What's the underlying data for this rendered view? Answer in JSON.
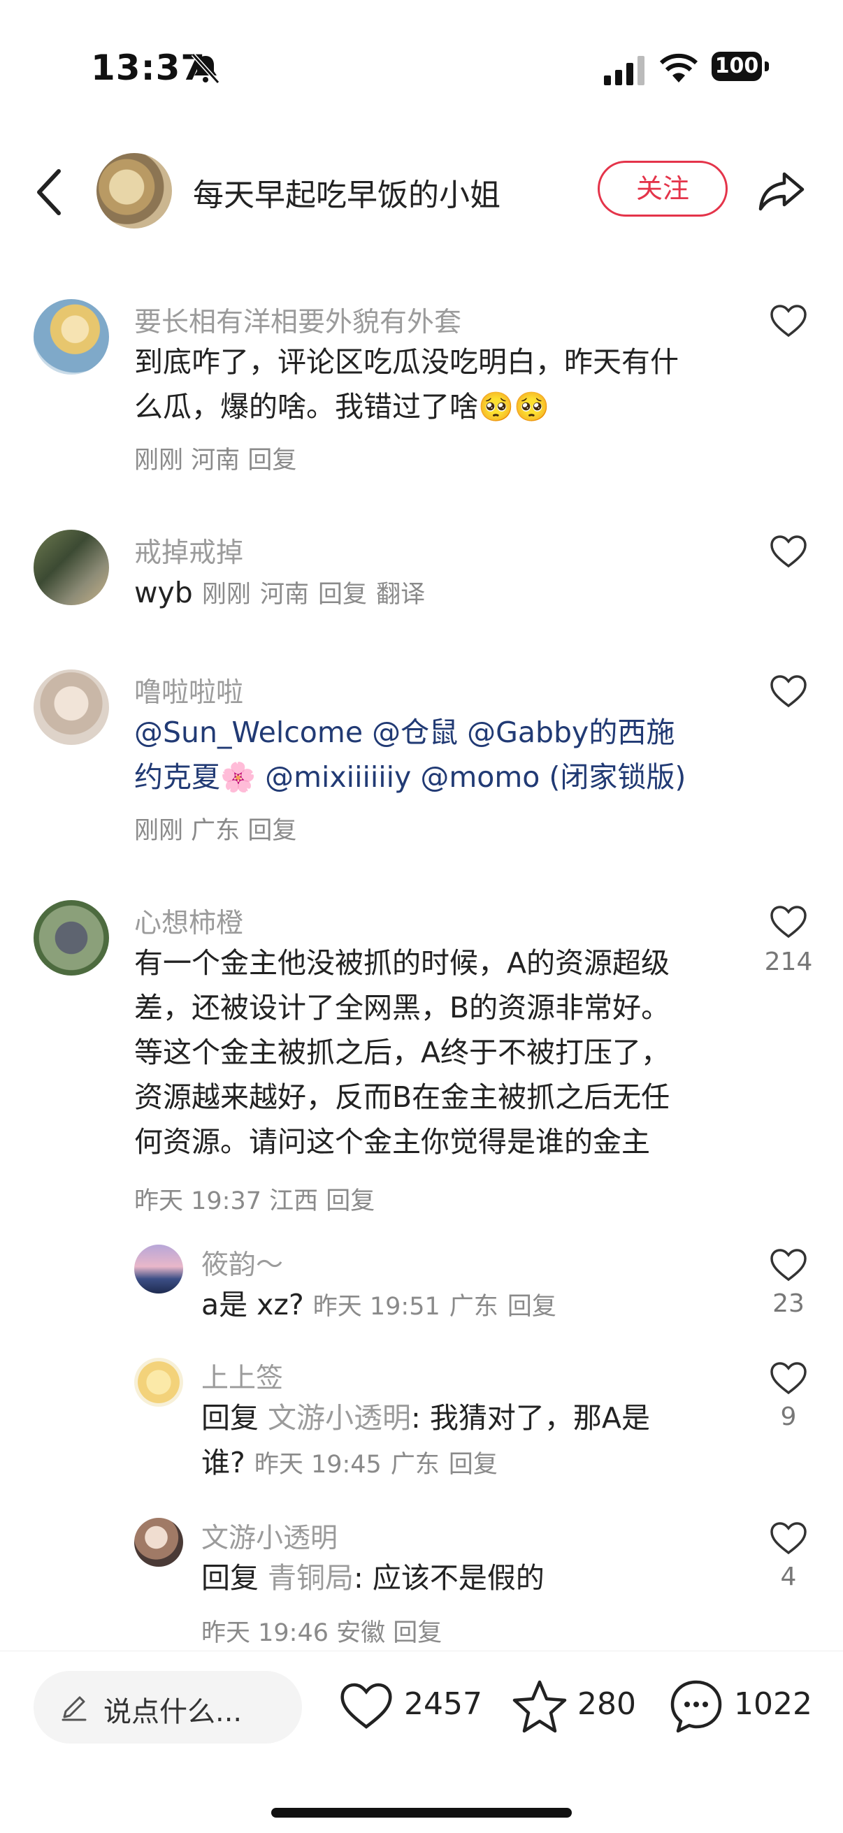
{
  "status_bar": {
    "time": "13:37",
    "battery": "100"
  },
  "header": {
    "title": "每天早起吃早饭的小姐",
    "follow_label": "关注"
  },
  "comments": [
    {
      "username": "要长相有洋相要外貌有外套",
      "text_line1": "到底咋了，评论区吃瓜没吃明白，昨天有什",
      "text_line2": "么瓜，爆的啥。我错过了啥🥺🥺",
      "time": "刚刚",
      "location": "河南",
      "reply": "回复"
    },
    {
      "username": "戒掉戒掉",
      "text": "wyb",
      "time": "刚刚",
      "location": "河南",
      "reply": "回复",
      "translate": "翻译"
    },
    {
      "username": "噜啦啦啦",
      "mention_line1": "@Sun_Welcome @仓鼠 @Gabby的西施",
      "mention_line2": "约克夏🌸 @mixiiiiiiy @momo (闭家锁版)",
      "time": "刚刚",
      "location": "广东",
      "reply": "回复"
    },
    {
      "username": "心想柿橙",
      "lines": [
        "有一个金主他没被抓的时候，A的资源超级",
        "差，还被设计了全网黑，B的资源非常好。",
        "等这个金主被抓之后，A终于不被打压了，",
        "资源越来越好，反而B在金主被抓之后无任",
        "何资源。请问这个金主你觉得是谁的金主"
      ],
      "time": "昨天 19:37",
      "location": "江西",
      "reply": "回复",
      "likes": "214"
    }
  ],
  "replies": [
    {
      "username": "筱韵～",
      "text": "a是 xz?",
      "time": "昨天 19:51",
      "location": "广东",
      "reply": "回复",
      "likes": "23"
    },
    {
      "username": "上上签",
      "prefix": "回复",
      "reply_to": "文游小透明",
      "text_line1": ": 我猜对了，那A是",
      "text_line2": "谁?",
      "time": "昨天 19:45",
      "location": "广东",
      "reply": "回复",
      "likes": "9"
    },
    {
      "username": "文游小透明",
      "prefix": "回复",
      "reply_to": "青铜局",
      "text": ": 应该不是假的",
      "time": "昨天 19:46",
      "location": "安徽",
      "reply": "回复",
      "likes": "4"
    }
  ],
  "bottom_bar": {
    "input_placeholder": "说点什么...",
    "like_count": "2457",
    "star_count": "280",
    "comment_count": "1022"
  }
}
